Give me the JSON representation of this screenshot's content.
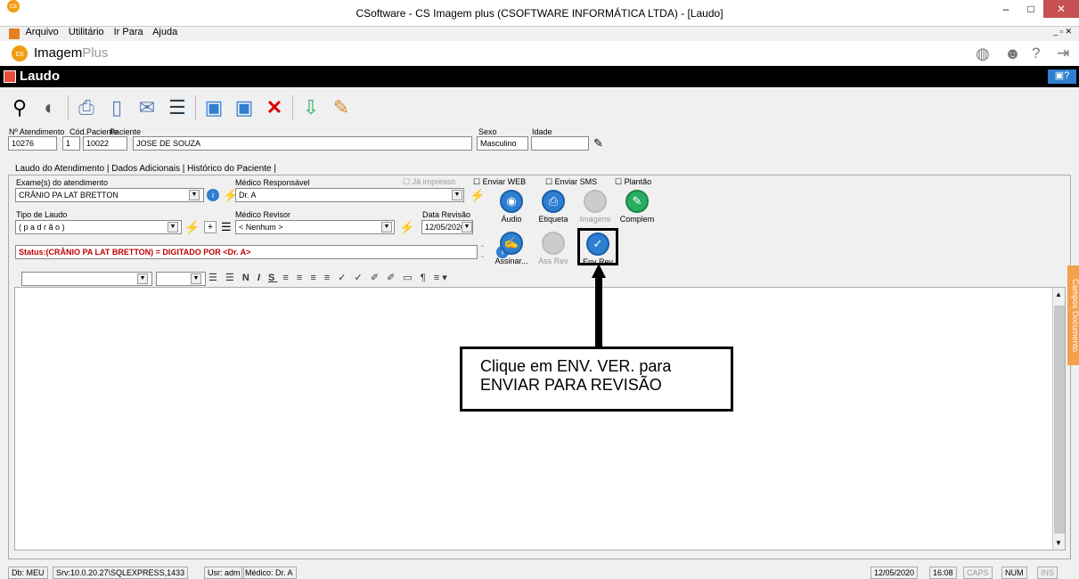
{
  "window": {
    "title": "CSoftware - CS Imagem plus (CSOFTWARE INFORMÁTICA LTDA) - [Laudo]"
  },
  "menu": [
    "Arquivo",
    "Utilitário",
    "Ir Para",
    "Ajuda"
  ],
  "brand": {
    "name": "Imagem",
    "suffix": "Plus"
  },
  "section_title": "Laudo",
  "patient": {
    "labels": {
      "atendimento": "Nº Atendimento",
      "cod_paciente": "Cód.Paciente",
      "paciente": "Paciente",
      "sexo": "Sexo",
      "idade": "Idade"
    },
    "atendimento": "10276",
    "seq": "1",
    "cod_paciente": "10022",
    "nome": "JOSE DE SOUZA",
    "sexo": "Masculino",
    "idade": ""
  },
  "tabs": [
    "Laudo do Atendimento",
    "Dados Adicionais",
    "Histórico do Paciente"
  ],
  "form": {
    "exames_label": "Exame(s) do atendimento",
    "exame": "CRÂNIO PA LAT BRETTON",
    "medico_resp_label": "Médico Responsável",
    "medico_resp": "Dr. A",
    "tipo_laudo_label": "Tipo de Laudo",
    "tipo_laudo": "( p a d r ã o )",
    "medico_rev_label": "Médico Revisor",
    "medico_rev": "< Nenhum >",
    "data_rev_label": "Data Revisão",
    "data_rev": "12/05/2020",
    "status": "Status:(CRÂNIO PA LAT BRETTON) = DIGITADO POR <Dr. A>"
  },
  "checks": [
    "Já impresso",
    "Enviar WEB",
    "Enviar SMS",
    "Plantão"
  ],
  "actions": [
    {
      "label": "Áudio",
      "enabled": true
    },
    {
      "label": "Etiqueta",
      "enabled": true
    },
    {
      "label": "Imagens",
      "enabled": false
    },
    {
      "label": "Complem",
      "enabled": true
    },
    {
      "label": "Assinar...",
      "enabled": true
    },
    {
      "label": "Ass Rev",
      "enabled": false
    },
    {
      "label": "Env Rev",
      "enabled": true
    }
  ],
  "callout": {
    "line1": "Clique em ENV. VER. para",
    "line2": "ENVIAR PARA REVISÃO"
  },
  "side_tab": "Campos Documento",
  "statusbar": {
    "db": "Db: MEU",
    "srv": "Srv:10.0.20.27\\SQLEXPRESS,1433",
    "usr": "Usr: adm",
    "medico": "Médico: Dr. A",
    "date": "12/05/2020",
    "time": "16:08",
    "caps": "CAPS",
    "num": "NUM",
    "ins": "INS"
  },
  "colors": {
    "accent": "#2e7fd1",
    "callout_border": "#000000",
    "status_text": "#c00000",
    "brand_orange": "#f39c12"
  }
}
